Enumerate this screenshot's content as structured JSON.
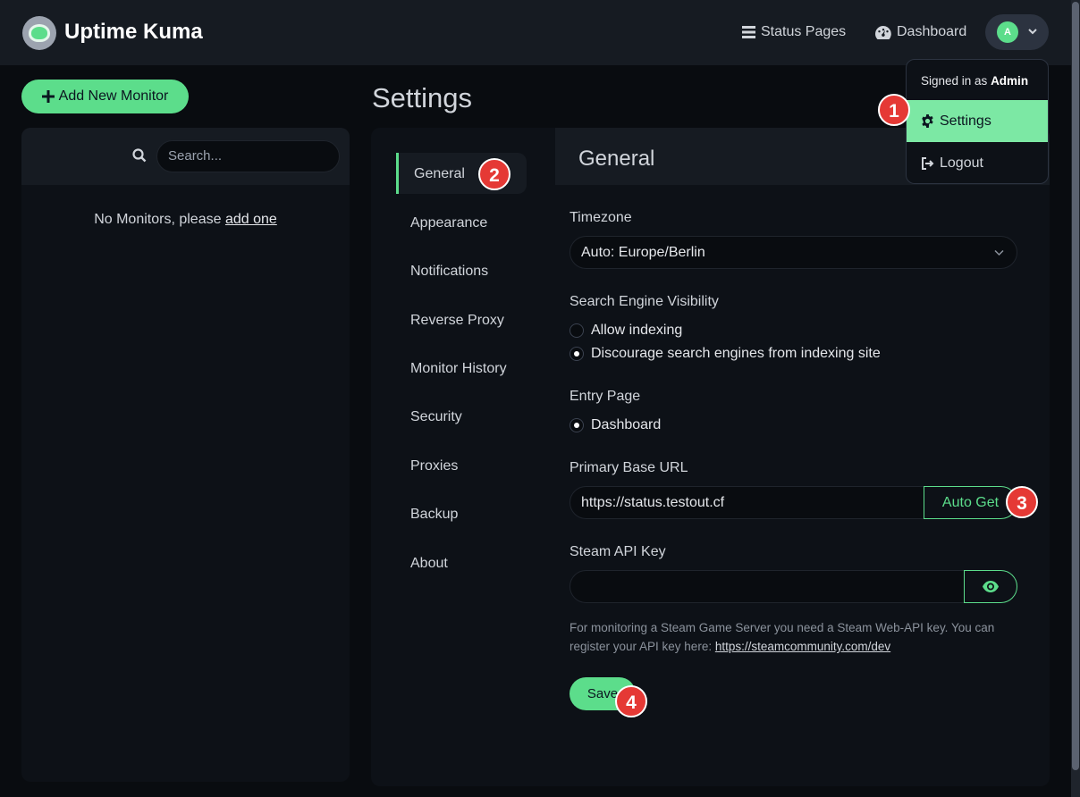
{
  "header": {
    "brand": "Uptime Kuma",
    "status_pages": "Status Pages",
    "dashboard": "Dashboard",
    "avatar_initial": "A"
  },
  "left": {
    "add_button": "Add New Monitor",
    "search_placeholder": "Search...",
    "empty_prefix": "No Monitors, please ",
    "empty_link": "add one"
  },
  "settings": {
    "title": "Settings",
    "menu": [
      "General",
      "Appearance",
      "Notifications",
      "Reverse Proxy",
      "Monitor History",
      "Security",
      "Proxies",
      "Backup",
      "About"
    ],
    "section_title": "General",
    "timezone_label": "Timezone",
    "timezone_value": "Auto: Europe/Berlin",
    "visibility_label": "Search Engine Visibility",
    "visibility_options": [
      "Allow indexing",
      "Discourage search engines from indexing site"
    ],
    "visibility_selected": 1,
    "entry_label": "Entry Page",
    "entry_option": "Dashboard",
    "base_url_label": "Primary Base URL",
    "base_url_value": "https://status.testout.cf",
    "auto_get": "Auto Get",
    "steam_label": "Steam API Key",
    "steam_value": "",
    "help_text": "For monitoring a Steam Game Server you need a Steam Web-API key. You can register your API key here: ",
    "help_link": "https://steamcommunity.com/dev",
    "save": "Save"
  },
  "dropdown": {
    "signed_in_prefix": "Signed in as ",
    "user": "Admin",
    "settings": "Settings",
    "logout": "Logout"
  },
  "badges": [
    "1",
    "2",
    "3",
    "4"
  ],
  "colors": {
    "accent": "#5cdd8b",
    "badge": "#e53935",
    "background": "#090c10",
    "panel": "#0d1117"
  }
}
